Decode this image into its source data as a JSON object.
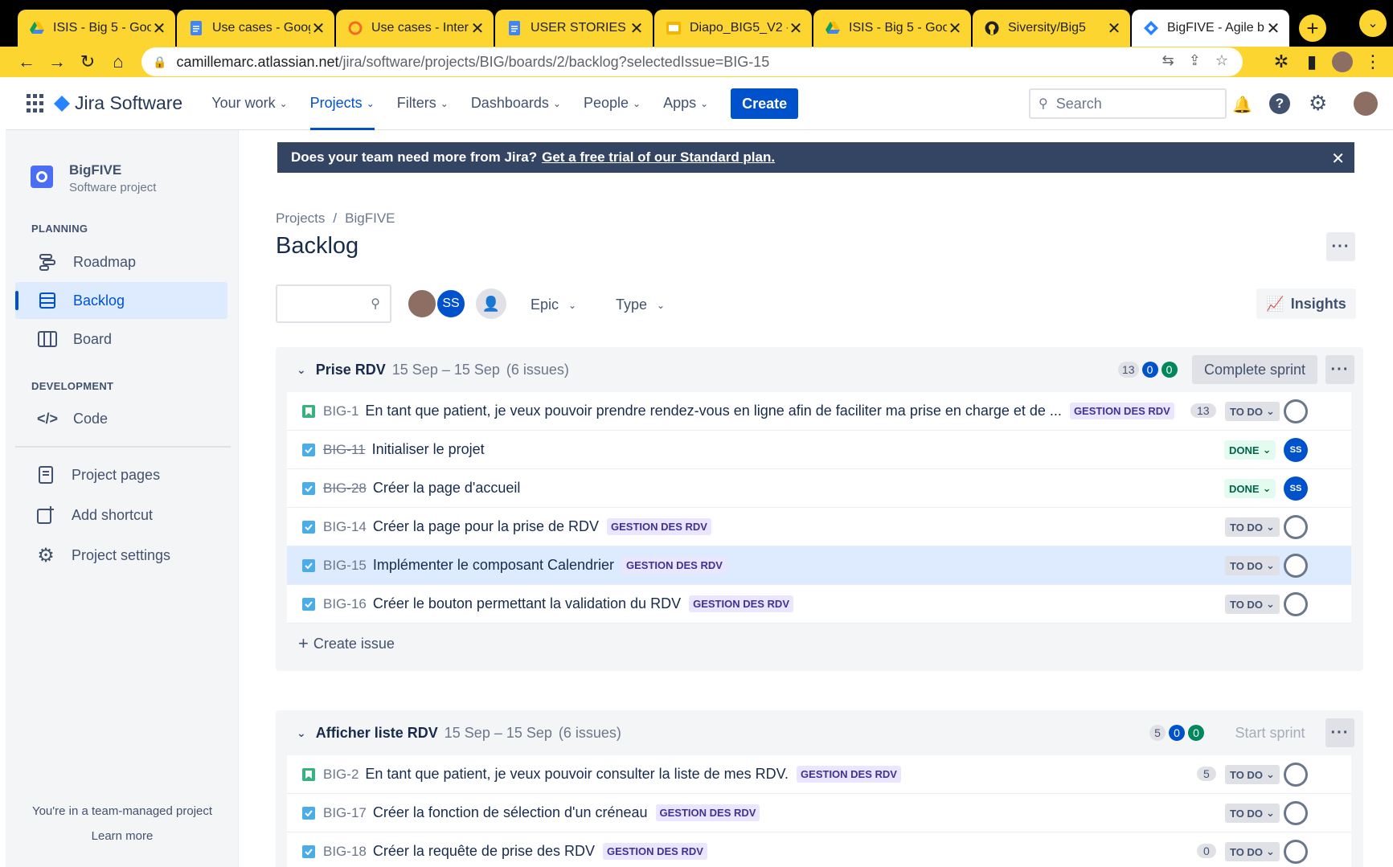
{
  "browser": {
    "tabs": [
      {
        "title": "ISIS - Big 5 - Goo",
        "icon": "google-drive-icon"
      },
      {
        "title": "Use cases - Goog",
        "icon": "google-docs-icon"
      },
      {
        "title": "Use cases - Inter",
        "icon": "diagram-app-icon"
      },
      {
        "title": "USER STORIES - (",
        "icon": "google-docs-icon"
      },
      {
        "title": "Diapo_BIG5_V2 -",
        "icon": "google-slides-icon"
      },
      {
        "title": "ISIS - Big 5 - Goo",
        "icon": "google-drive-icon"
      },
      {
        "title": "Siversity/Big5",
        "icon": "github-icon"
      },
      {
        "title": "BigFIVE - Agile b",
        "icon": "jira-icon"
      }
    ],
    "url_domain": "camillemarc.atlassian.net",
    "url_path": "/jira/software/projects/BIG/boards/2/backlog?selectedIssue=BIG-15"
  },
  "header": {
    "logo": "Jira Software",
    "nav": [
      "Your work",
      "Projects",
      "Filters",
      "Dashboards",
      "People",
      "Apps"
    ],
    "create": "Create",
    "search_placeholder": "Search"
  },
  "sidebar": {
    "project_name": "BigFIVE",
    "project_type": "Software project",
    "planning_header": "PLANNING",
    "roadmap": "Roadmap",
    "backlog": "Backlog",
    "board": "Board",
    "development_header": "DEVELOPMENT",
    "code": "Code",
    "project_pages": "Project pages",
    "add_shortcut": "Add shortcut",
    "project_settings": "Project settings",
    "footer_text": "You're in a team-managed project",
    "learn_more": "Learn more"
  },
  "banner": {
    "text": "Does your team need more from Jira?",
    "link": "Get a free trial of our Standard plan."
  },
  "page": {
    "breadcrumb_projects": "Projects",
    "breadcrumb_sep": "/",
    "breadcrumb_project": "BigFIVE",
    "title": "Backlog",
    "avatar_initials": "SS",
    "epic_filter": "Epic",
    "type_filter": "Type",
    "insights": "Insights"
  },
  "sprint1": {
    "name": "Prise RDV",
    "dates": "15 Sep – 15 Sep",
    "count": "(6 issues)",
    "pts_todo": "13",
    "pts_progress": "0",
    "pts_done": "0",
    "action": "Complete sprint",
    "create_issue": "Create issue",
    "issues": [
      {
        "key": "BIG-1",
        "summary": "En tant que patient, je veux pouvoir prendre rendez-vous en ligne afin de faciliter ma prise en charge et de ...",
        "epic": "GESTION DES RDV",
        "points": "13",
        "status": "TO DO",
        "type": "story",
        "assignee": ""
      },
      {
        "key": "BIG-11",
        "summary": "Initialiser le projet",
        "epic": "",
        "points": "",
        "status": "DONE",
        "type": "task",
        "assignee": "SS"
      },
      {
        "key": "BIG-28",
        "summary": "Créer la page d'accueil",
        "epic": "",
        "points": "",
        "status": "DONE",
        "type": "task",
        "assignee": "SS"
      },
      {
        "key": "BIG-14",
        "summary": "Créer la page pour la prise de RDV",
        "epic": "GESTION DES RDV",
        "points": "",
        "status": "TO DO",
        "type": "task",
        "assignee": ""
      },
      {
        "key": "BIG-15",
        "summary": "Implémenter le composant Calendrier",
        "epic": "GESTION DES RDV",
        "points": "",
        "status": "TO DO",
        "type": "task",
        "assignee": ""
      },
      {
        "key": "BIG-16",
        "summary": "Créer le bouton permettant la validation du RDV",
        "epic": "GESTION DES RDV",
        "points": "",
        "status": "TO DO",
        "type": "task",
        "assignee": ""
      }
    ]
  },
  "sprint2": {
    "name": "Afficher liste RDV",
    "dates": "15 Sep – 15 Sep",
    "count": "(6 issues)",
    "pts_todo": "5",
    "pts_progress": "0",
    "pts_done": "0",
    "action": "Start sprint",
    "issues": [
      {
        "key": "BIG-2",
        "summary": "En tant que patient, je veux pouvoir consulter la liste de mes RDV.",
        "epic": "GESTION DES RDV",
        "points": "5",
        "status": "TO DO",
        "type": "story",
        "assignee": ""
      },
      {
        "key": "BIG-17",
        "summary": "Créer la fonction de sélection d'un créneau",
        "epic": "GESTION DES RDV",
        "points": "",
        "status": "TO DO",
        "type": "task",
        "assignee": ""
      },
      {
        "key": "BIG-18",
        "summary": "Créer la requête de prise des RDV",
        "epic": "GESTION DES RDV",
        "points": "0",
        "status": "TO DO",
        "type": "task",
        "assignee": ""
      }
    ]
  }
}
